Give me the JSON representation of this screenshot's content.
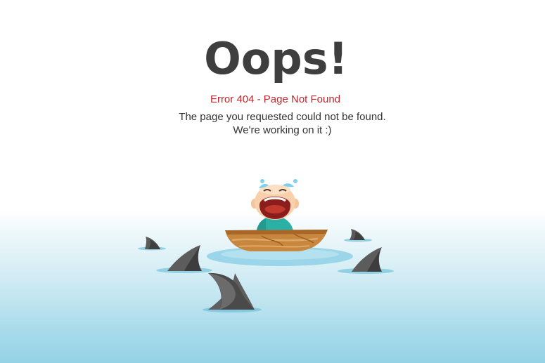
{
  "heading": "Oops!",
  "error_code": "Error 404 - Page Not Found",
  "message_line1": "The page you requested could not be found.",
  "message_line2": "We're working on it :)",
  "colors": {
    "heading": "#3e3e3e",
    "error": "#c0272d",
    "text": "#333333",
    "water": "#94d2e6",
    "shark_fin": "#555555",
    "boat": "#c98a45"
  },
  "illustration": {
    "icon": "crying-child-in-boat-surrounded-by-sharks-illustration"
  }
}
